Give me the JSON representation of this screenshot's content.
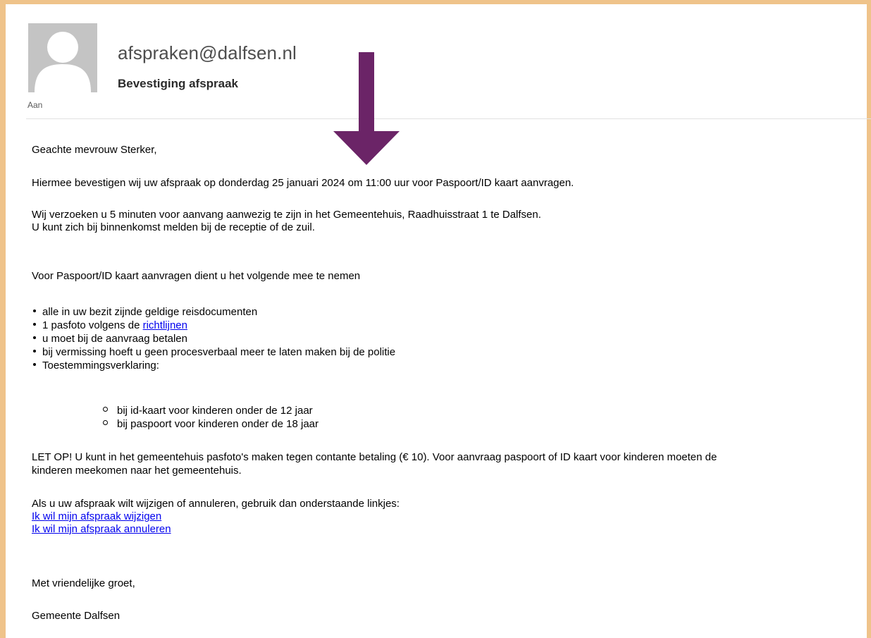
{
  "email": {
    "sender": "afspraken@dalfsen.nl",
    "subject": "Bevestiging afspraak",
    "to_label": "Aan"
  },
  "body": {
    "greeting": "Geachte mevrouw Sterker,",
    "confirmation": "Hiermee bevestigen wij uw afspraak op donderdag 25 januari 2024 om 11:00 uur voor Paspoort/ID kaart aanvragen.",
    "arrival_line1": "Wij verzoeken u 5 minuten voor aanvang aanwezig te zijn in het Gemeentehuis, Raadhuisstraat 1 te Dalfsen.",
    "arrival_line2": "U kunt zich bij binnenkomst melden bij de receptie of de zuil.",
    "bring_intro": "Voor Paspoort/ID kaart aanvragen dient u het volgende mee te nemen",
    "bullets": [
      "alle in uw bezit zijnde geldige reisdocumenten",
      "1 pasfoto volgens de ",
      "u moet bij de aanvraag betalen",
      "bij vermissing hoeft u geen procesverbaal meer te laten maken bij de politie",
      "Toestemmingsverklaring:"
    ],
    "bullet_link": "richtlijnen",
    "sub_bullets": [
      "bij id-kaart voor kinderen onder de 12 jaar",
      "bij paspoort voor kinderen onder de 18 jaar"
    ],
    "note_line1": "LET OP!  U kunt in het gemeentehuis pasfoto's maken tegen contante betaling (€ 10). Voor aanvraag paspoort of ID kaart voor kinderen moeten de",
    "note_line2": "kinderen meekomen naar het gemeentehuis.",
    "change_intro": "Als u uw afspraak wilt wijzigen of annuleren, gebruik dan onderstaande linkjes:",
    "link_change": "Ik wil mijn afspraak wijzigen",
    "link_cancel": "Ik wil mijn afspraak annuleren",
    "closing": "Met vriendelijke groet,",
    "signature": "Gemeente Dalfsen"
  },
  "colors": {
    "frame": "#efc38a",
    "arrow": "#6b2467",
    "link": "#0000ee"
  },
  "icons": {
    "avatar": "person-silhouette-icon",
    "annotation": "arrow-down-icon"
  }
}
